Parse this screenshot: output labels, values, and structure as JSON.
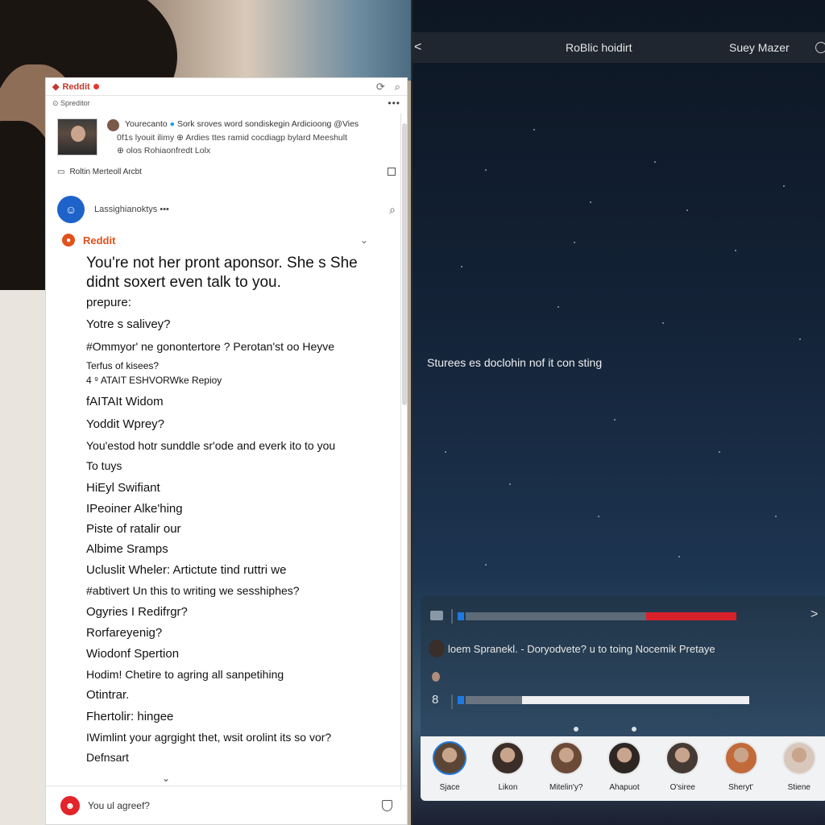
{
  "reddit": {
    "topbar": {
      "brand": "Reddit"
    },
    "subbar": {
      "text": "Spreditor",
      "more": "•••"
    },
    "card": {
      "line1_name": "Yourecanto",
      "line1_rest": "Sork sroves word sondiskegin Ardicioong @Vies",
      "line2": "0f1s lyouit ilimy  ⊕  Ardies ttes ramid cocdiagp bylard    Meeshult",
      "line3": "⊕ olos Rohiaonfredt Lolx"
    },
    "row_a": "Roltin Merteoll Arcbt",
    "user": {
      "name": "Lassighianoktys"
    },
    "sub": {
      "label": "Reddit"
    },
    "post": {
      "headline": "You're not her pront aponsor. She s She didnt  soxert even talk to you.",
      "lines": [
        "prepure:",
        "Yotre s salivey?",
        "#Ommyor' ne gonontertore ? Perotan'st oo Heyve",
        "Terfus of kisees?",
        "4  ⁹  ATAIT ESHVORWke Repioy",
        "fAITAIt Widom",
        "Yoddit Wprey?",
        "You'estod hotr sunddle sr'ode and everk ito to you",
        "To tuys",
        "HiEyl Swifiant",
        "IPeoiner Alke'hing",
        "Piste of ratalir our",
        "Albime Sramps",
        "Ucluslit Wheler: Artictute tind ruttri we",
        "#abtivert Un this to writing we sesshiphes?",
        "Ogyries I Redifrgr?",
        "Rorfareyenig?",
        "Wiodonf Spertion",
        "Hodim! Chetire to agring all sanpetihing",
        "Otintrar.",
        "Fhertolir: hingee",
        "IWimlint your agrgight thet, wsit orolint its so vor?",
        "Defnsart"
      ]
    },
    "footer": {
      "text": "You ul agreef?"
    }
  },
  "right": {
    "bar": {
      "back": "<",
      "title": "RoBlic hoidirt",
      "user": "Suey Mazer"
    },
    "caption": "Sturees es doclohin nof it con sting",
    "card": {
      "row_text": "loem  Spranekl.  -  Doryodvete?  u to toing Nocemik Pretaye",
      "eight": "8",
      "chevron": ">"
    },
    "avatars": [
      {
        "name": "Sjace",
        "active": true
      },
      {
        "name": "Likon",
        "active": false
      },
      {
        "name": "Mitelin'y?",
        "active": false
      },
      {
        "name": "Ahapuot",
        "active": false
      },
      {
        "name": "O'siree",
        "active": false
      },
      {
        "name": "Sheryt'",
        "active": false
      },
      {
        "name": "Stiene",
        "active": false
      }
    ]
  }
}
